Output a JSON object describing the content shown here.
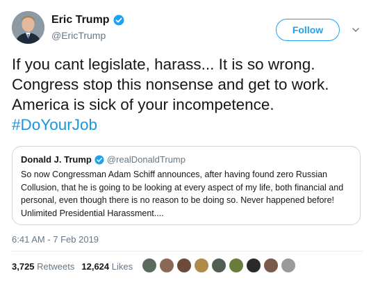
{
  "author": {
    "name": "Eric Trump",
    "handle": "@EricTrump",
    "verified": true
  },
  "actions": {
    "follow_label": "Follow",
    "menu_icon": "chevron-down-icon"
  },
  "tweet": {
    "text": "If you cant legislate, harass... It is so wrong. Congress stop this nonsense and get to work. America is sick of your incompetence.",
    "hashtag": "#DoYourJob",
    "timestamp": "6:41 AM - 7 Feb 2019"
  },
  "quoted_tweet": {
    "name": "Donald J. Trump",
    "handle": "@realDonaldTrump",
    "verified": true,
    "text": "So now Congressman Adam Schiff announces, after having found zero Russian Collusion, that he is going to be looking at every aspect of my life, both financial and personal, even though there is no reason to be doing so. Never happened before! Unlimited Presidential Harassment...."
  },
  "stats": {
    "retweets_count": "3,725",
    "retweets_label": "Retweets",
    "likes_count": "12,624",
    "likes_label": "Likes"
  },
  "likers": [
    {
      "name": "liker-avatar",
      "color": "#5a6b5e"
    },
    {
      "name": "liker-avatar",
      "color": "#8a6a55"
    },
    {
      "name": "liker-avatar",
      "color": "#6d4a3a"
    },
    {
      "name": "liker-avatar",
      "color": "#b08a4a"
    },
    {
      "name": "liker-avatar",
      "color": "#4f5f52"
    },
    {
      "name": "liker-avatar",
      "color": "#6a7c3c"
    },
    {
      "name": "liker-avatar",
      "color": "#2a2a2a"
    },
    {
      "name": "liker-avatar",
      "color": "#7a5a4a"
    },
    {
      "name": "liker-avatar",
      "color": "#9a9a9a"
    }
  ],
  "colors": {
    "accent": "#1da1f2",
    "hashtag": "#1b95e0",
    "secondary_text": "#657786",
    "border": "#ccd6dd"
  }
}
